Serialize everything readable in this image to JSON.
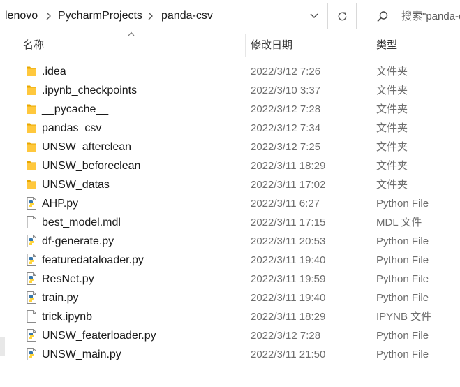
{
  "address_bar": {
    "crumbs": [
      "lenovo",
      "PycharmProjects",
      "panda-csv"
    ]
  },
  "search": {
    "placeholder": "搜索\"panda-csv\""
  },
  "columns": {
    "name": "名称",
    "date": "修改日期",
    "type": "类型"
  },
  "files": [
    {
      "name": ".idea",
      "date": "2022/3/12 7:26",
      "type": "文件夹",
      "icon": "folder-icon"
    },
    {
      "name": ".ipynb_checkpoints",
      "date": "2022/3/10 3:37",
      "type": "文件夹",
      "icon": "folder-icon"
    },
    {
      "name": "__pycache__",
      "date": "2022/3/12 7:28",
      "type": "文件夹",
      "icon": "folder-icon"
    },
    {
      "name": "pandas_csv",
      "date": "2022/3/12 7:34",
      "type": "文件夹",
      "icon": "folder-icon"
    },
    {
      "name": "UNSW_afterclean",
      "date": "2022/3/12 7:25",
      "type": "文件夹",
      "icon": "folder-icon"
    },
    {
      "name": "UNSW_beforeclean",
      "date": "2022/3/11 18:29",
      "type": "文件夹",
      "icon": "folder-icon"
    },
    {
      "name": "UNSW_datas",
      "date": "2022/3/11 17:02",
      "type": "文件夹",
      "icon": "folder-icon"
    },
    {
      "name": "AHP.py",
      "date": "2022/3/11 6:27",
      "type": "Python File",
      "icon": "python-file-icon"
    },
    {
      "name": "best_model.mdl",
      "date": "2022/3/11 17:15",
      "type": "MDL 文件",
      "icon": "blank-file-icon"
    },
    {
      "name": "df-generate.py",
      "date": "2022/3/11 20:53",
      "type": "Python File",
      "icon": "python-file-icon"
    },
    {
      "name": "featuredataloader.py",
      "date": "2022/3/11 19:40",
      "type": "Python File",
      "icon": "python-file-icon"
    },
    {
      "name": "ResNet.py",
      "date": "2022/3/11 19:59",
      "type": "Python File",
      "icon": "python-file-icon"
    },
    {
      "name": "train.py",
      "date": "2022/3/11 19:40",
      "type": "Python File",
      "icon": "python-file-icon"
    },
    {
      "name": "trick.ipynb",
      "date": "2022/3/11 18:29",
      "type": "IPYNB 文件",
      "icon": "blank-file-icon"
    },
    {
      "name": "UNSW_featerloader.py",
      "date": "2022/3/12 7:28",
      "type": "Python File",
      "icon": "python-file-icon"
    },
    {
      "name": "UNSW_main.py",
      "date": "2022/3/11 21:50",
      "type": "Python File",
      "icon": "python-file-icon"
    }
  ]
}
